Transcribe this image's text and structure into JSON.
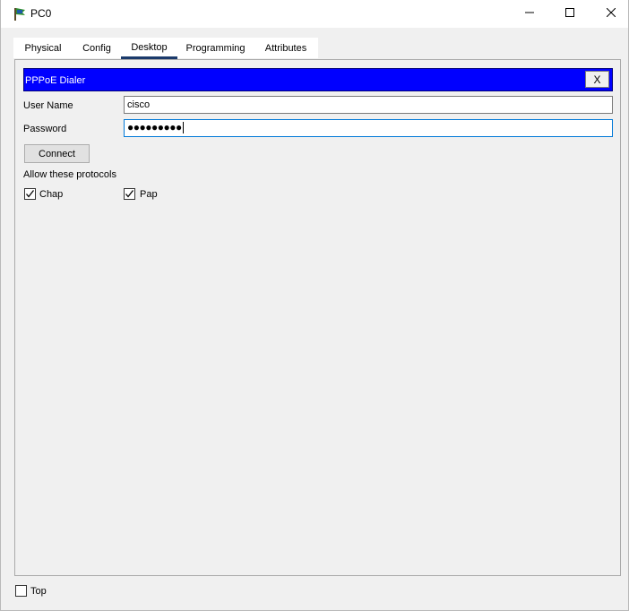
{
  "window": {
    "title": "PC0",
    "icon": "pc-app-icon",
    "controls": [
      "minimize-icon",
      "maximize-icon",
      "close-icon"
    ]
  },
  "tabs": [
    {
      "label": "Physical",
      "active": false
    },
    {
      "label": "Config",
      "active": false
    },
    {
      "label": "Desktop",
      "active": true
    },
    {
      "label": "Programming",
      "active": false
    },
    {
      "label": "Attributes",
      "active": false
    }
  ],
  "dialer": {
    "title": "PPPoE Dialer",
    "close_label": "X",
    "username_label": "User Name",
    "username_value": "cisco",
    "password_label": "Password",
    "password_value": "●●●●●●●●●",
    "connect_label": "Connect",
    "protocols_label": "Allow these protocols",
    "protocols": [
      {
        "label": "Chap",
        "checked": true
      },
      {
        "label": "Pap",
        "checked": true
      }
    ]
  },
  "footer": {
    "top_label": "Top",
    "top_checked": false
  },
  "colors": {
    "header_blue": "#0000ff",
    "tab_active_underline": "#1b3a6b",
    "focus_border": "#0078d7"
  }
}
